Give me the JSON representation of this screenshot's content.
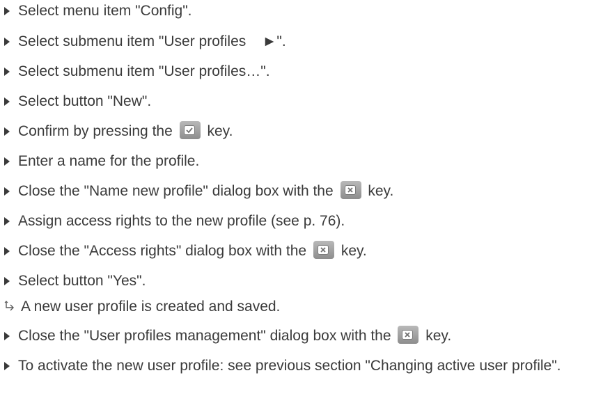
{
  "steps": [
    {
      "text": "Select menu item \"Config\"."
    },
    {
      "text": "Select submenu item \"User profiles    ►\"."
    },
    {
      "text": "Select submenu item \"User profiles…\"."
    },
    {
      "text": "Select button \"New\"."
    },
    {
      "before": "Confirm by pressing the",
      "key_icon": "confirm-key-icon",
      "after": "key."
    },
    {
      "text": "Enter a name for the profile."
    },
    {
      "before": "Close the \"Name new profile\" dialog box with the",
      "key_icon": "close-key-icon",
      "after": "key."
    },
    {
      "text": "Assign access rights to the new profile (see p. 76)."
    },
    {
      "before": "Close the \"Access rights\" dialog box with the",
      "key_icon": "close-key-icon",
      "after": "key."
    },
    {
      "text": "Select button \"Yes\"."
    },
    {
      "result": "A new user profile is created and saved."
    },
    {
      "before": "Close the \"User profiles management\" dialog box with the",
      "key_icon": "close-key-icon",
      "after": "key."
    },
    {
      "text": "To activate the new user profile: see previous section \"Changing active user profile\"."
    }
  ],
  "colors": {
    "text": "#3a3a3a",
    "key_background": "#9a9a9a",
    "key_face": "#ffffff"
  }
}
